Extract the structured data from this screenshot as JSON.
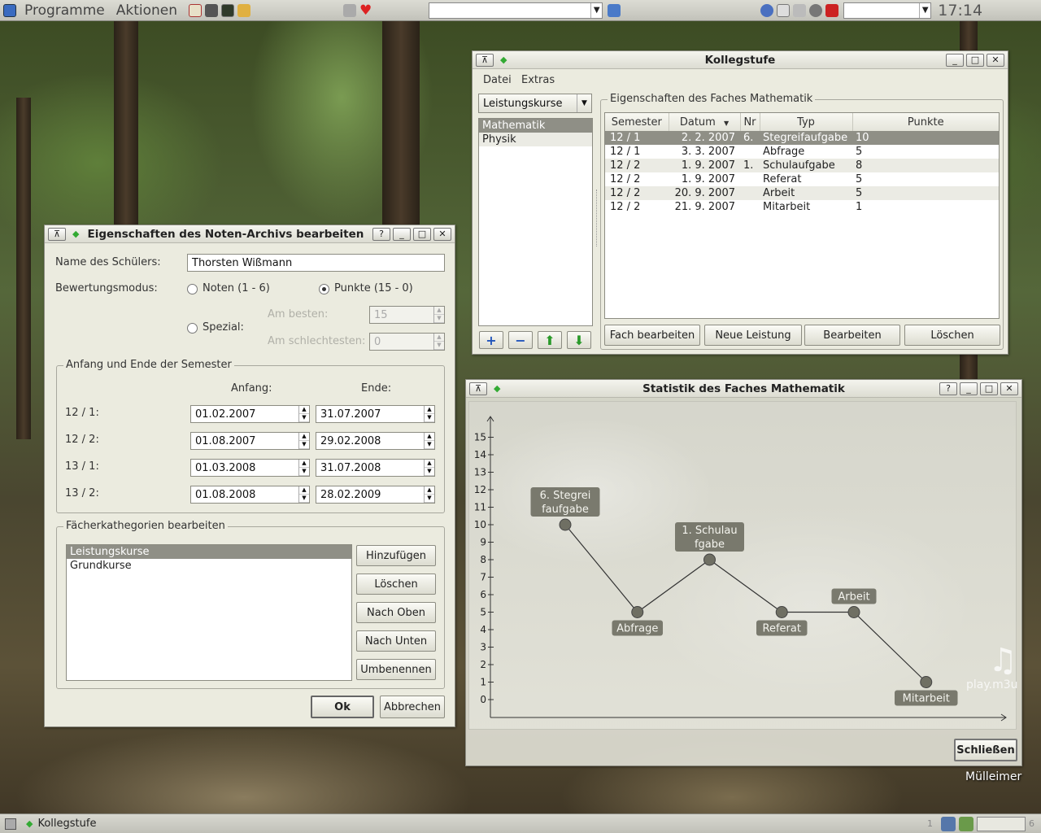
{
  "top_panel": {
    "menu1": "Programme",
    "menu2": "Aktionen",
    "clock": "17:14"
  },
  "kollegstufe": {
    "title": "Kollegstufe",
    "menu": [
      "Datei",
      "Extras"
    ],
    "course_combo": "Leistungskurse",
    "subjects": [
      "Mathematik",
      "Physik"
    ],
    "props_title": "Eigenschaften des Faches Mathematik",
    "columns": [
      "Semester",
      "Datum",
      "Nr",
      "Typ",
      "Punkte"
    ],
    "rows": [
      {
        "semester": "12 / 1",
        "datum": "2.  2. 2007",
        "nr": "6.",
        "typ": "Stegreifaufgabe",
        "punkte": "10"
      },
      {
        "semester": "12 / 1",
        "datum": "3.  3. 2007",
        "nr": "",
        "typ": "Abfrage",
        "punkte": "5"
      },
      {
        "semester": "12 / 2",
        "datum": "1.  9. 2007",
        "nr": "1.",
        "typ": "Schulaufgabe",
        "punkte": "8"
      },
      {
        "semester": "12 / 2",
        "datum": "1.  9. 2007",
        "nr": "",
        "typ": "Referat",
        "punkte": "5"
      },
      {
        "semester": "12 / 2",
        "datum": "20.  9. 2007",
        "nr": "",
        "typ": "Arbeit",
        "punkte": "5"
      },
      {
        "semester": "12 / 2",
        "datum": "21.  9. 2007",
        "nr": "",
        "typ": "Mitarbeit",
        "punkte": "1"
      }
    ],
    "buttons": {
      "fach": "Fach bearbeiten",
      "neu": "Neue Leistung",
      "bearbeiten": "Bearbeiten",
      "loeschen": "Löschen"
    }
  },
  "archive": {
    "title": "Eigenschaften des Noten-Archivs bearbeiten",
    "name_label": "Name des Schülers:",
    "name_value": "Thorsten Wißmann",
    "mode_label": "Bewertungsmodus:",
    "noten": "Noten (1 - 6)",
    "punkte": "Punkte (15 - 0)",
    "spezial": "Spezial:",
    "am_besten": "Am besten:",
    "am_besten_val": "15",
    "am_schlechtesten": "Am schlechtesten:",
    "am_schlechtesten_val": "0",
    "semester_frame": "Anfang und Ende der Semester",
    "anfang": "Anfang:",
    "ende": "Ende:",
    "semesters": [
      {
        "label": "12 / 1:",
        "start": "01.02.2007",
        "end": "31.07.2007"
      },
      {
        "label": "12 / 2:",
        "start": "01.08.2007",
        "end": "29.02.2008"
      },
      {
        "label": "13 / 1:",
        "start": "01.03.2008",
        "end": "31.07.2008"
      },
      {
        "label": "13 / 2:",
        "start": "01.08.2008",
        "end": "28.02.2009"
      }
    ],
    "cat_frame": "Fächerkathegorien bearbeiten",
    "categories": [
      "Leistungskurse",
      "Grundkurse"
    ],
    "cat_buttons": [
      "Hinzufügen",
      "Löschen",
      "Nach Oben",
      "Nach Unten",
      "Umbenennen"
    ],
    "ok": "Ok",
    "cancel": "Abbrechen"
  },
  "stats": {
    "title": "Statistik des Faches Mathematik",
    "close": "Schließen"
  },
  "chart_data": {
    "type": "line",
    "ylim": [
      0,
      15
    ],
    "yticks": [
      "15",
      "14",
      "13",
      "12",
      "11",
      "10",
      "9",
      "8",
      "7",
      "6",
      "5",
      "4",
      "3",
      "2",
      "1",
      "0"
    ],
    "points": [
      {
        "label": "6. Stegrei faufgabe",
        "value": 10
      },
      {
        "label": "Abfrage",
        "value": 5
      },
      {
        "label": "1. Schulau fgabe",
        "value": 8
      },
      {
        "label": "Referat",
        "value": 5
      },
      {
        "label": "Arbeit",
        "value": 5
      },
      {
        "label": "Mitarbeit",
        "value": 1
      }
    ]
  },
  "desktop": {
    "playlist": "play.m3u",
    "trash": "Mülleimer"
  },
  "taskbar": {
    "task": "Kollegstufe",
    "desk1": "1",
    "desk6": "6"
  }
}
